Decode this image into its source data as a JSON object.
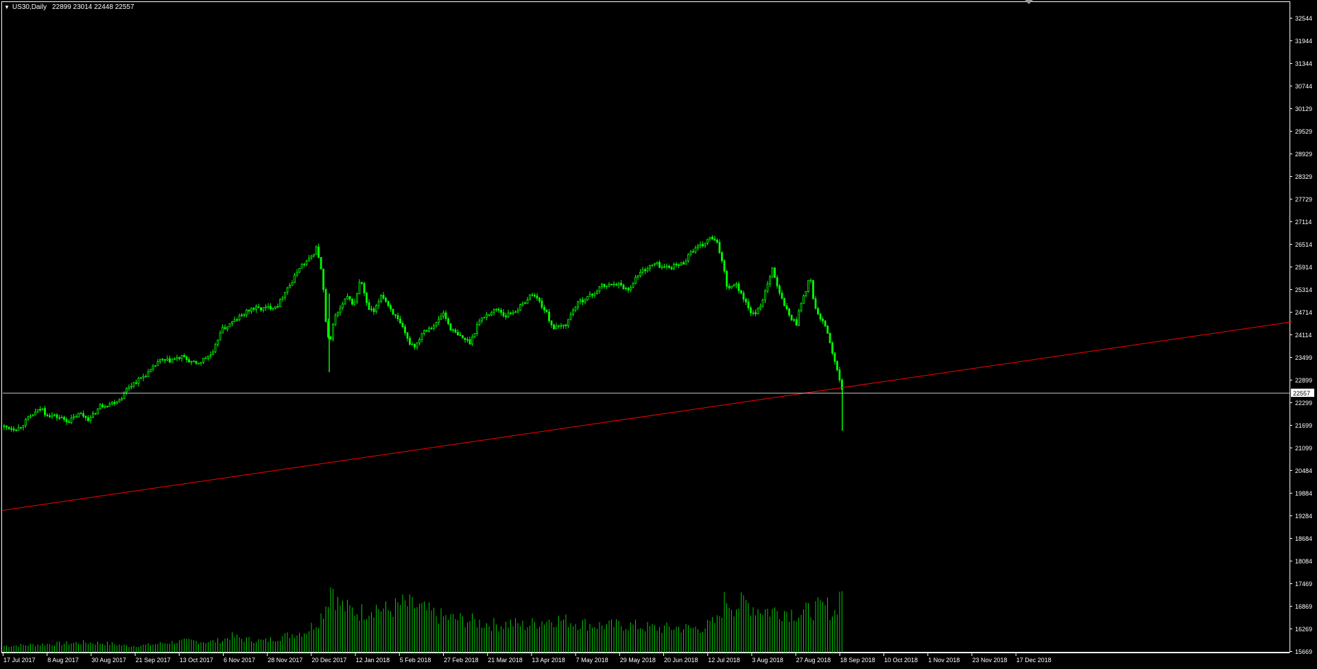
{
  "window": {
    "symbol": "US30,Daily",
    "ohlc": "22899 23014 22448 22557",
    "bg_color": "#000000",
    "candle_color": "#00ff00",
    "volume_color": "#00cc00",
    "axis_color": "#ffffff",
    "trendline_color": "#ff0000",
    "price_line_color": "#c0c0c0"
  },
  "chart_data": {
    "type": "candlestick",
    "title": "US30,Daily",
    "price_axis": {
      "ticks": [
        32544,
        31944,
        31344,
        30744,
        30129,
        29529,
        28929,
        28329,
        27729,
        27114,
        26514,
        25914,
        25314,
        24714,
        24114,
        23499,
        22899,
        22299,
        21699,
        21099,
        20484,
        19884,
        19284,
        18684,
        18084,
        17469,
        16869,
        16269,
        15669
      ],
      "range": [
        15500,
        32700
      ],
      "current_price": 22557
    },
    "time_axis": {
      "labels": [
        "17 Jul 2017",
        "8 Aug 2017",
        "30 Aug 2017",
        "21 Sep 2017",
        "13 Oct 2017",
        "6 Nov 2017",
        "28 Nov 2017",
        "20 Dec 2017",
        "12 Jan 2018",
        "5 Feb 2018",
        "27 Feb 2018",
        "21 Mar 2018",
        "13 Apr 2018",
        "7 May 2018",
        "29 May 2018",
        "20 Jun 2018",
        "12 Jul 2018",
        "3 Aug 2018",
        "27 Aug 2018",
        "18 Sep 2018",
        "10 Oct 2018",
        "1 Nov 2018",
        "23 Nov 2018",
        "17 Dec 2018"
      ]
    },
    "close_path": [
      [
        0,
        21650
      ],
      [
        20,
        21600
      ],
      [
        40,
        21950
      ],
      [
        55,
        22150
      ],
      [
        60,
        22000
      ],
      [
        80,
        21900
      ],
      [
        95,
        21800
      ],
      [
        110,
        22000
      ],
      [
        125,
        21850
      ],
      [
        140,
        22200
      ],
      [
        160,
        22300
      ],
      [
        170,
        22400
      ],
      [
        180,
        22700
      ],
      [
        200,
        22950
      ],
      [
        215,
        23150
      ],
      [
        225,
        23400
      ],
      [
        240,
        23400
      ],
      [
        260,
        23500
      ],
      [
        280,
        23300
      ],
      [
        295,
        23500
      ],
      [
        305,
        23600
      ],
      [
        315,
        24200
      ],
      [
        330,
        24400
      ],
      [
        345,
        24600
      ],
      [
        360,
        24800
      ],
      [
        380,
        24800
      ],
      [
        400,
        24900
      ],
      [
        410,
        25300
      ],
      [
        420,
        25500
      ],
      [
        430,
        25900
      ],
      [
        445,
        26100
      ],
      [
        455,
        26400
      ],
      [
        460,
        26100
      ],
      [
        465,
        25400
      ],
      [
        470,
        24200
      ],
      [
        475,
        23800
      ],
      [
        480,
        24500
      ],
      [
        490,
        24800
      ],
      [
        500,
        25100
      ],
      [
        510,
        24900
      ],
      [
        520,
        25600
      ],
      [
        530,
        24800
      ],
      [
        540,
        24700
      ],
      [
        550,
        25200
      ],
      [
        560,
        24900
      ],
      [
        570,
        24600
      ],
      [
        580,
        24300
      ],
      [
        590,
        23900
      ],
      [
        600,
        23800
      ],
      [
        610,
        24200
      ],
      [
        620,
        24300
      ],
      [
        630,
        24400
      ],
      [
        640,
        24700
      ],
      [
        650,
        24300
      ],
      [
        660,
        24100
      ],
      [
        670,
        24000
      ],
      [
        680,
        23900
      ],
      [
        690,
        24400
      ],
      [
        700,
        24600
      ],
      [
        710,
        24700
      ],
      [
        720,
        24800
      ],
      [
        730,
        24600
      ],
      [
        740,
        24700
      ],
      [
        750,
        24800
      ],
      [
        760,
        25000
      ],
      [
        770,
        25200
      ],
      [
        780,
        25000
      ],
      [
        790,
        24700
      ],
      [
        800,
        24300
      ],
      [
        810,
        24300
      ],
      [
        820,
        24400
      ],
      [
        830,
        24800
      ],
      [
        840,
        25000
      ],
      [
        850,
        25100
      ],
      [
        860,
        25200
      ],
      [
        870,
        25400
      ],
      [
        880,
        25400
      ],
      [
        890,
        25500
      ],
      [
        900,
        25400
      ],
      [
        910,
        25300
      ],
      [
        920,
        25600
      ],
      [
        930,
        25800
      ],
      [
        940,
        25900
      ],
      [
        950,
        26000
      ],
      [
        960,
        25900
      ],
      [
        970,
        25900
      ],
      [
        980,
        25950
      ],
      [
        990,
        26000
      ],
      [
        1000,
        26300
      ],
      [
        1010,
        26400
      ],
      [
        1020,
        26500
      ],
      [
        1030,
        26700
      ],
      [
        1040,
        26500
      ],
      [
        1048,
        26000
      ],
      [
        1055,
        25300
      ],
      [
        1065,
        25500
      ],
      [
        1075,
        25200
      ],
      [
        1085,
        24800
      ],
      [
        1095,
        24600
      ],
      [
        1105,
        25000
      ],
      [
        1115,
        25600
      ],
      [
        1120,
        25900
      ],
      [
        1128,
        25300
      ],
      [
        1135,
        25000
      ],
      [
        1145,
        24600
      ],
      [
        1150,
        24500
      ],
      [
        1155,
        24400
      ],
      [
        1160,
        24900
      ],
      [
        1170,
        25300
      ],
      [
        1175,
        25700
      ],
      [
        1180,
        25000
      ],
      [
        1185,
        24700
      ],
      [
        1190,
        24500
      ],
      [
        1195,
        24400
      ],
      [
        1200,
        24200
      ],
      [
        1205,
        23800
      ],
      [
        1210,
        23400
      ],
      [
        1215,
        23100
      ],
      [
        1220,
        22700
      ],
      [
        1225,
        22600
      ]
    ],
    "volume_range": [
      0,
      100
    ],
    "volume_path": [
      [
        0,
        8
      ],
      [
        30,
        9
      ],
      [
        60,
        10
      ],
      [
        90,
        11
      ],
      [
        120,
        12
      ],
      [
        150,
        11
      ],
      [
        180,
        8
      ],
      [
        210,
        9
      ],
      [
        240,
        12
      ],
      [
        270,
        14
      ],
      [
        300,
        13
      ],
      [
        320,
        15
      ],
      [
        330,
        20
      ],
      [
        350,
        16
      ],
      [
        380,
        14
      ],
      [
        400,
        18
      ],
      [
        420,
        22
      ],
      [
        440,
        25
      ],
      [
        460,
        40
      ],
      [
        470,
        60
      ],
      [
        478,
        85
      ],
      [
        485,
        60
      ],
      [
        500,
        52
      ],
      [
        520,
        48
      ],
      [
        540,
        55
      ],
      [
        560,
        50
      ],
      [
        580,
        58
      ],
      [
        600,
        55
      ],
      [
        620,
        48
      ],
      [
        640,
        42
      ],
      [
        660,
        40
      ],
      [
        680,
        38
      ],
      [
        700,
        35
      ],
      [
        720,
        33
      ],
      [
        740,
        35
      ],
      [
        760,
        32
      ],
      [
        780,
        37
      ],
      [
        800,
        40
      ],
      [
        820,
        38
      ],
      [
        840,
        35
      ],
      [
        860,
        33
      ],
      [
        880,
        32
      ],
      [
        900,
        33
      ],
      [
        920,
        32
      ],
      [
        940,
        30
      ],
      [
        960,
        29
      ],
      [
        980,
        30
      ],
      [
        1000,
        29
      ],
      [
        1020,
        30
      ],
      [
        1040,
        38
      ],
      [
        1052,
        65
      ],
      [
        1065,
        55
      ],
      [
        1080,
        60
      ],
      [
        1100,
        52
      ],
      [
        1120,
        50
      ],
      [
        1140,
        50
      ],
      [
        1160,
        46
      ],
      [
        1180,
        52
      ],
      [
        1200,
        55
      ],
      [
        1210,
        45
      ],
      [
        1222,
        80
      ],
      [
        1225,
        50
      ]
    ],
    "trendline": {
      "start": {
        "x_index": 0,
        "price": 19420
      },
      "end": {
        "x_index": 1880,
        "price": 24450
      }
    }
  }
}
